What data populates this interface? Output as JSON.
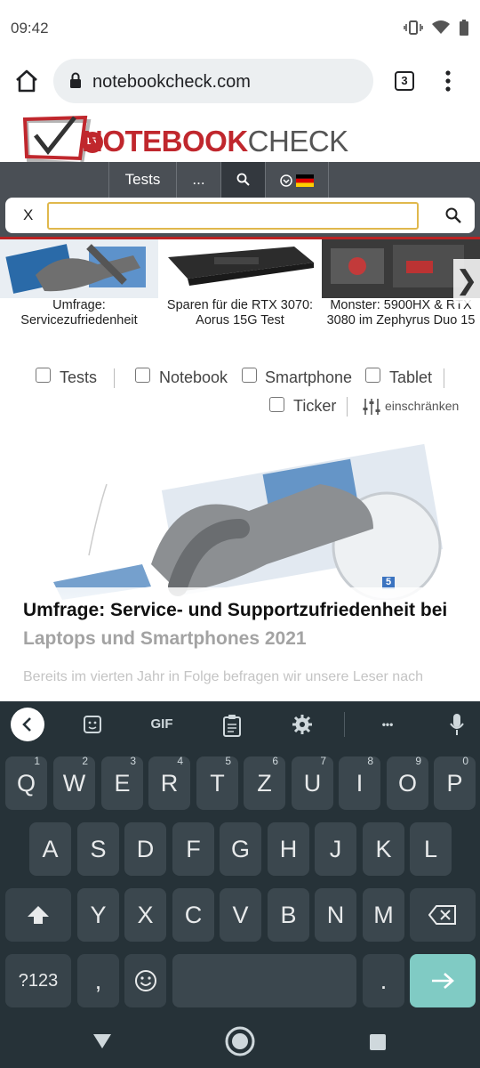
{
  "status_bar": {
    "time": "09:42",
    "icons": [
      "vibrate-icon",
      "wifi-icon",
      "battery-icon"
    ]
  },
  "browser": {
    "url": "notebookcheck.com",
    "tab_count": "3"
  },
  "site": {
    "logo_badge": "15",
    "logo_part1": "NOTEBOOK",
    "logo_part2": "CHECK",
    "nav": {
      "tests": "Tests",
      "more": "..."
    },
    "search": {
      "close": "X",
      "value": ""
    }
  },
  "carousel": [
    {
      "caption": "Umfrage: Servicezufriedenheit"
    },
    {
      "caption": "Sparen für die RTX 3070: Aorus 15G Test"
    },
    {
      "caption": "Monster: 5900HX & RTX 3080 im Zephyrus Duo 15"
    }
  ],
  "filters": {
    "items": [
      "Tests",
      "Notebook",
      "Smartphone",
      "Tablet",
      "Ticker"
    ],
    "restrict": "einschränken"
  },
  "article": {
    "image_badge": "5",
    "headline_line1": "Umfrage: Service- und Supportzufriedenheit bei",
    "headline_line2": "Laptops und Smartphones 2021",
    "teaser": "Bereits im vierten Jahr in Folge befragen wir unsere Leser nach"
  },
  "keyboard": {
    "toolbar": {
      "gif": "GIF",
      "more": "•••"
    },
    "row1": [
      {
        "k": "Q",
        "h": "1"
      },
      {
        "k": "W",
        "h": "2"
      },
      {
        "k": "E",
        "h": "3"
      },
      {
        "k": "R",
        "h": "4"
      },
      {
        "k": "T",
        "h": "5"
      },
      {
        "k": "Z",
        "h": "6"
      },
      {
        "k": "U",
        "h": "7"
      },
      {
        "k": "I",
        "h": "8"
      },
      {
        "k": "O",
        "h": "9"
      },
      {
        "k": "P",
        "h": "0"
      }
    ],
    "row2": [
      "A",
      "S",
      "D",
      "F",
      "G",
      "H",
      "J",
      "K",
      "L"
    ],
    "row3": [
      "Y",
      "X",
      "C",
      "V",
      "B",
      "N",
      "M"
    ],
    "symbols": "?123",
    "comma": ",",
    "period": "."
  },
  "colors": {
    "accent_red": "#c0272d",
    "nav_gray": "#4a4f55",
    "keyboard_bg": "#263238",
    "enter_key": "#80cbc4",
    "search_border": "#e0b84c"
  }
}
